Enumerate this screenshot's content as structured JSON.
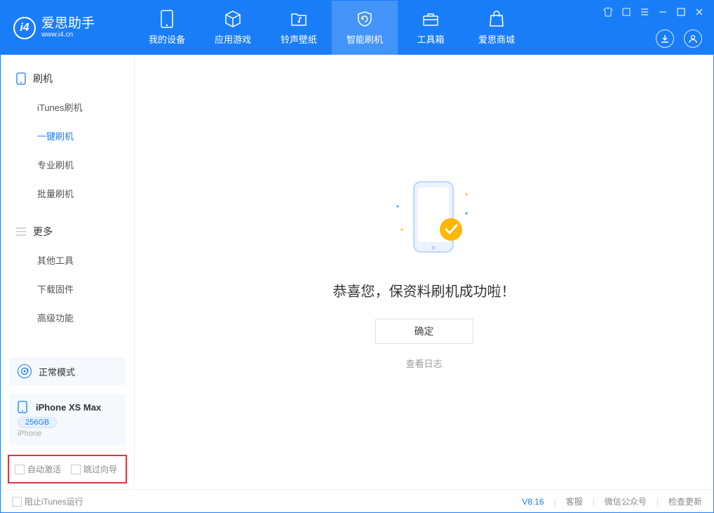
{
  "app": {
    "title": "爱思助手",
    "subtitle": "www.i4.cn"
  },
  "nav": {
    "tabs": [
      {
        "label": "我的设备"
      },
      {
        "label": "应用游戏"
      },
      {
        "label": "铃声壁纸"
      },
      {
        "label": "智能刷机"
      },
      {
        "label": "工具箱"
      },
      {
        "label": "爱思商城"
      }
    ]
  },
  "sidebar": {
    "section1": {
      "title": "刷机",
      "items": [
        "iTunes刷机",
        "一键刷机",
        "专业刷机",
        "批量刷机"
      ]
    },
    "section2": {
      "title": "更多",
      "items": [
        "其他工具",
        "下载固件",
        "高级功能"
      ]
    },
    "mode_label": "正常模式",
    "device": {
      "name": "iPhone XS Max",
      "storage": "256GB",
      "type": "iPhone"
    },
    "checkbox1": "自动激活",
    "checkbox2": "跳过向导"
  },
  "main": {
    "success_text": "恭喜您，保资料刷机成功啦！",
    "ok_button": "确定",
    "view_log": "查看日志"
  },
  "status": {
    "block_itunes": "阻止iTunes运行",
    "version": "V8.16",
    "links": [
      "客服",
      "微信公众号",
      "检查更新"
    ]
  },
  "colors": {
    "primary": "#1a7df8",
    "accent": "#ffb700"
  }
}
